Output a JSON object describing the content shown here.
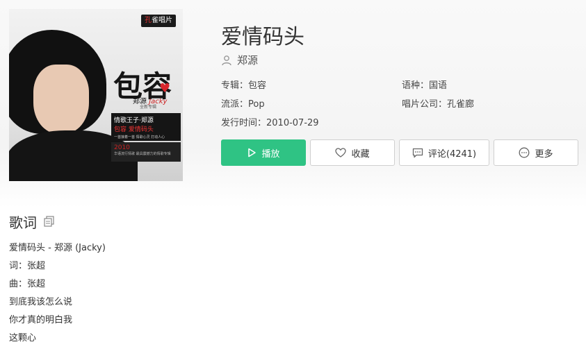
{
  "cover": {
    "badge_prefix": "孔",
    "badge_text": "雀唱片",
    "big_title": "包容",
    "artist_cn": "郑源",
    "artist_en": "Jacky",
    "sub_tag": "全新专辑",
    "promo_line1": "情歌王子·郑源",
    "promo_line2_a": "包容",
    "promo_line2_b": "爱情码头",
    "promo_small": "一首接着一首 情歌心灵 打动人心",
    "year": "2010",
    "year_small": "华语流行情歌 最具震撼力的情歌专辑"
  },
  "song": {
    "title": "爱情码头",
    "artist": "郑源"
  },
  "meta": {
    "album": "专辑：包容",
    "language": "语种：国语",
    "genre": "流派：Pop",
    "label": "唱片公司：孔雀廊",
    "release": "发行时间：2010-07-29"
  },
  "actions": {
    "play": "播放",
    "favorite": "收藏",
    "comment": "评论(4241)",
    "more": "更多"
  },
  "lyrics": {
    "heading": "歌词",
    "lines": [
      "爱情码头 - 郑源 (Jacky)",
      "词：张超",
      "曲：张超",
      "到底我该怎么说",
      "你才真的明白我",
      "这颗心"
    ]
  },
  "colors": {
    "accent_green": "#2fc384"
  }
}
